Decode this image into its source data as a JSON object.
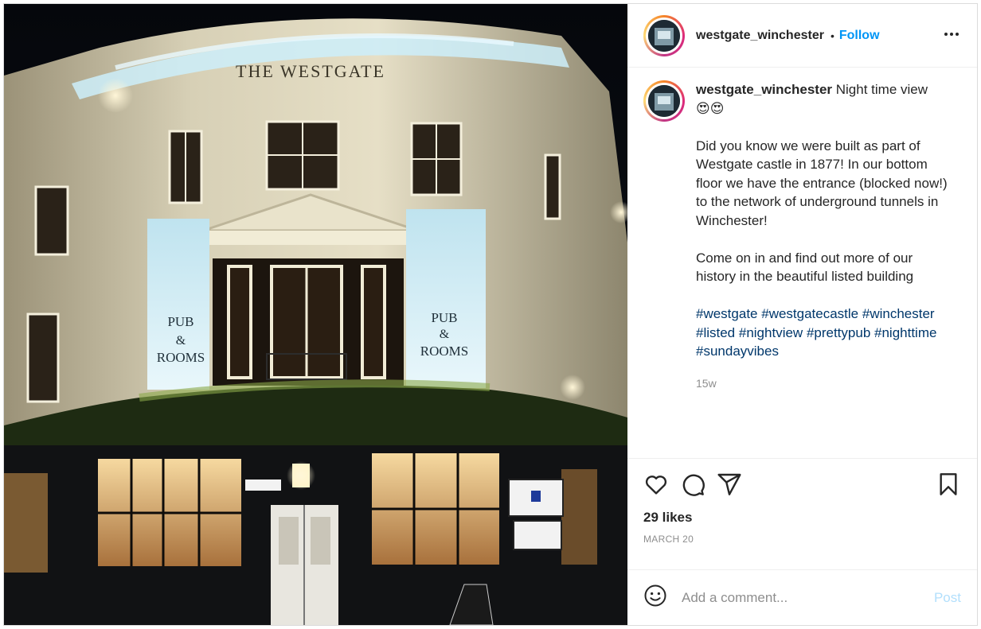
{
  "post": {
    "image_alt": "The Westgate pub at night",
    "sign_top": "THE WESTGATE",
    "sign_left": "PUB & ROOMS",
    "sign_right": "PUB & ROOMS"
  },
  "header": {
    "username": "westgate_winchester",
    "separator": "•",
    "follow_label": "Follow",
    "more_label": "•••"
  },
  "caption": {
    "username": "westgate_winchester",
    "line1": "Night time view",
    "emojis": "😍😍",
    "para1": "Did you know we were built as part of Westgate castle in 1877! In our bottom floor we have the entrance (blocked now!) to the network of underground tunnels in Winchester!",
    "para2": "Come on in and find out more of our history in the beautiful listed building",
    "hashtags": [
      "#westgate",
      "#westgatecastle",
      "#winchester",
      "#listed",
      "#nightview",
      "#prettypub",
      "#nighttime",
      "#sundayvibes"
    ],
    "time_ago": "15w"
  },
  "actions": {
    "likes": "29 likes",
    "date": "MARCH 20"
  },
  "comment": {
    "placeholder": "Add a comment...",
    "post_label": "Post"
  },
  "colors": {
    "link": "#0095f6",
    "hashtag": "#00376b",
    "muted": "#8e8e8e",
    "post_disabled": "#b2dffc"
  },
  "icons": [
    "heart-icon",
    "comment-icon",
    "share-icon",
    "bookmark-icon",
    "smiley-icon",
    "more-options-icon"
  ]
}
